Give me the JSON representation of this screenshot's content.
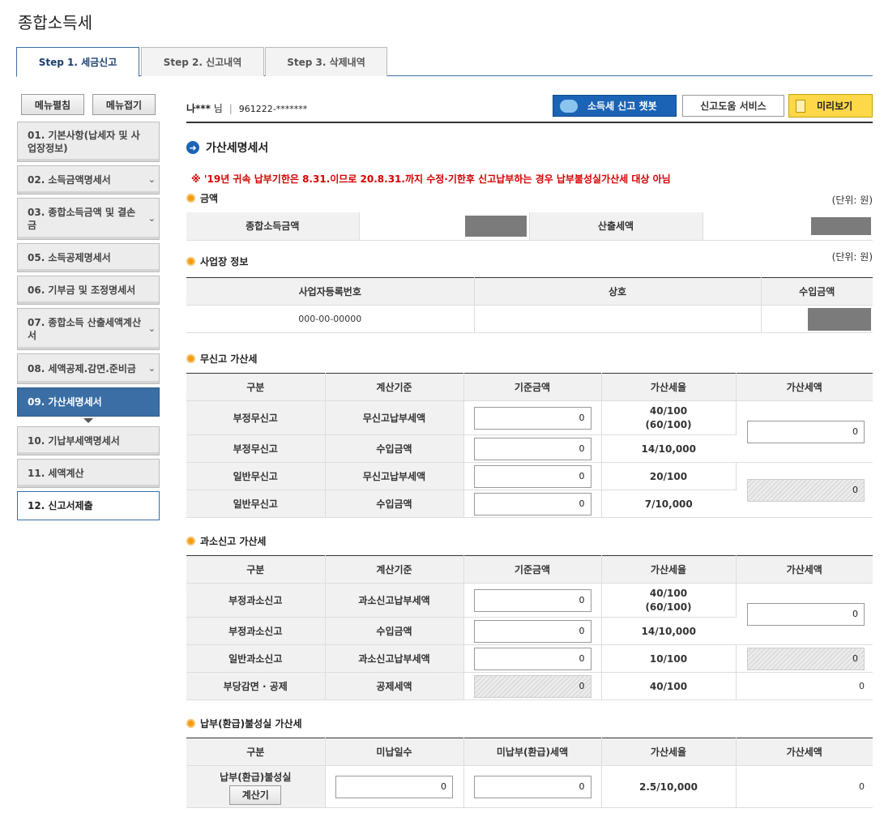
{
  "page": {
    "title": "종합소득세"
  },
  "tabs": [
    {
      "label": "Step 1. 세금신고"
    },
    {
      "label": "Step 2. 신고내역"
    },
    {
      "label": "Step 3. 삭제내역"
    }
  ],
  "sidebar": {
    "expand_label": "메뉴펼침",
    "collapse_label": "메뉴접기",
    "items": [
      {
        "label": "01. 기본사항(납세자 및 사업장정보)"
      },
      {
        "label": "02. 소득금액명세서"
      },
      {
        "label": "03. 종합소득금액 및 결손금"
      },
      {
        "label": "05. 소득공제명세서"
      },
      {
        "label": "06. 기부금 및 조정명세서"
      },
      {
        "label": "07. 종합소득 산출세액계산서"
      },
      {
        "label": "08. 세액공제.감면.준비금"
      },
      {
        "label": "09. 가산세명세서"
      },
      {
        "label": "10. 기납부세액명세서"
      },
      {
        "label": "11. 세액계산"
      },
      {
        "label": "12. 신고서제출"
      }
    ]
  },
  "user": {
    "name": "나***",
    "suffix": "님",
    "id": "961222-*******"
  },
  "buttons": {
    "chatbot": "소득세 신고 챗봇",
    "help": "신고도움 서비스",
    "preview": "미리보기"
  },
  "section": {
    "title": "가산세명세서",
    "notice": "※ '19년 귀속 납부기한은 8.31.이므로 20.8.31.까지 수정·기한후 신고납부하는 경우 납부불성실가산세 대상 아님"
  },
  "amount": {
    "title": "금액",
    "unit": "(단위: 원)",
    "income_label": "종합소득금액",
    "tax_label": "산출세액"
  },
  "business": {
    "title": "사업장 정보",
    "unit": "(단위: 원)",
    "headers": [
      "사업자등록번호",
      "상호",
      "수입금액"
    ],
    "row": {
      "reg_no": "000-00-00000",
      "name": ""
    }
  },
  "nonfiling": {
    "title": "무신고 가산세",
    "headers": [
      "구분",
      "계산기준",
      "기준금액",
      "가산세율",
      "가산세액"
    ],
    "rows": [
      {
        "type": "부정무신고",
        "basis": "무신고납부세액",
        "amount": "0",
        "rate": "40/100",
        "rate2": "(60/100)"
      },
      {
        "type": "부정무신고",
        "basis": "수입금액",
        "amount": "0",
        "rate": "14/10,000"
      },
      {
        "type": "일반무신고",
        "basis": "무신고납부세액",
        "amount": "0",
        "rate": "20/100"
      },
      {
        "type": "일반무신고",
        "basis": "수입금액",
        "amount": "0",
        "rate": "7/10,000"
      }
    ],
    "tax_fraud": "0",
    "tax_general": "0"
  },
  "underreport": {
    "title": "과소신고 가산세",
    "headers": [
      "구분",
      "계산기준",
      "기준금액",
      "가산세율",
      "가산세액"
    ],
    "rows": [
      {
        "type": "부정과소신고",
        "basis": "과소신고납부세액",
        "amount": "0",
        "rate": "40/100",
        "rate2": "(60/100)"
      },
      {
        "type": "부정과소신고",
        "basis": "수입금액",
        "amount": "0",
        "rate": "14/10,000"
      },
      {
        "type": "일반과소신고",
        "basis": "과소신고납부세액",
        "amount": "0",
        "rate": "10/100"
      },
      {
        "type": "부당감면 · 공제",
        "basis": "공제세액",
        "amount": "0",
        "rate": "40/100"
      }
    ],
    "tax_fraud": "0",
    "tax_general": "0",
    "tax_deduction": "0"
  },
  "latepay": {
    "title": "납부(환급)불성실 가산세",
    "headers": [
      "구분",
      "미납일수",
      "미납부(환급)세액",
      "가산세율",
      "가산세액"
    ],
    "row": {
      "type": "납부(환급)불성실",
      "calc_label": "계산기",
      "days": "0",
      "unpaid": "0",
      "rate": "2.5/10,000",
      "tax": "0"
    }
  }
}
